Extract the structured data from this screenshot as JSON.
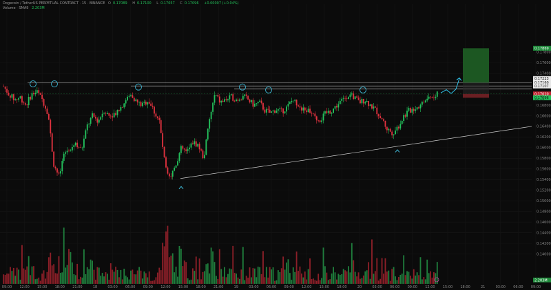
{
  "header": {
    "symbol": "Dogecoin / TetherUS PERPETUAL CONTRACT · 15 · BINANCE",
    "o_label": "O",
    "o_val": "0.17089",
    "h_label": "H",
    "h_val": "0.17100",
    "l_label": "L",
    "l_val": "0.17057",
    "c_label": "C",
    "c_val": "0.17096",
    "chg_val": "+0.00007 (+0.04%)",
    "vol_label": "Volume · SMA9",
    "vol_val": "2.203M"
  },
  "tags": {
    "target": "0.17869",
    "resistance": "0.17223",
    "mid1": "0.17160",
    "mid2": "0.17107",
    "stop": "0.17010",
    "price": "0.17096",
    "price_time": "08:25",
    "vol_tag": "2.203M"
  },
  "chart_data": {
    "type": "candlestick",
    "y_ticks": [
      "0.17800",
      "0.17600",
      "0.17400",
      "0.17200",
      "0.17000",
      "0.16800",
      "0.16600",
      "0.16400",
      "0.16200",
      "0.16000",
      "0.15800",
      "0.15600",
      "0.15400",
      "0.15200",
      "0.15000",
      "0.14800",
      "0.14600",
      "0.14400",
      "0.14200",
      "0.14000"
    ],
    "x_ticks": [
      "09:00",
      "12:00",
      "15:00",
      "18:00",
      "21:00",
      "18",
      "03:00",
      "06:00",
      "09:00",
      "12:00",
      "15:00",
      "18:00",
      "21:00",
      "19",
      "03:00",
      "06:00",
      "09:00",
      "12:00",
      "15:00",
      "18:00",
      "20",
      "03:00",
      "06:00",
      "09:00",
      "12:00",
      "15:00",
      "18:00",
      "21",
      "03:00",
      "06:00",
      "09:00"
    ],
    "ylim": [
      0.134,
      0.187
    ],
    "resistance_level": 0.17223,
    "trendline": {
      "start": 0.1542,
      "end": 0.164
    },
    "colors": {
      "up": "#23c15c",
      "down": "#e0323f",
      "vol_up": "#1f7d3c",
      "vol_down": "#8c1f28",
      "line": "#cfcfcf",
      "arrow": "#2fc0e6",
      "target_zone": "#1e5c24",
      "stop_zone": "#6b1f23"
    },
    "path": [
      0.1715,
      0.17,
      0.169,
      0.1695,
      0.168,
      0.17,
      0.1705,
      0.169,
      0.1665,
      0.157,
      0.1545,
      0.159,
      0.16,
      0.161,
      0.1595,
      0.164,
      0.166,
      0.165,
      0.167,
      0.166,
      0.1665,
      0.1675,
      0.169,
      0.17,
      0.1685,
      0.168,
      0.169,
      0.167,
      0.165,
      0.157,
      0.1545,
      0.157,
      0.16,
      0.159,
      0.161,
      0.1605,
      0.158,
      0.165,
      0.17,
      0.1685,
      0.169,
      0.1695,
      0.169,
      0.1698,
      0.169,
      0.168,
      0.1685,
      0.167,
      0.1665,
      0.1672,
      0.1668,
      0.1676,
      0.169,
      0.1682,
      0.167,
      0.167,
      0.1655,
      0.1652,
      0.1665,
      0.167,
      0.168,
      0.169,
      0.17,
      0.1695,
      0.1685,
      0.169,
      0.168,
      0.167,
      0.1655,
      0.1635,
      0.1628,
      0.164,
      0.166,
      0.167,
      0.1675,
      0.168,
      0.169,
      0.1695,
      0.1702
    ]
  }
}
